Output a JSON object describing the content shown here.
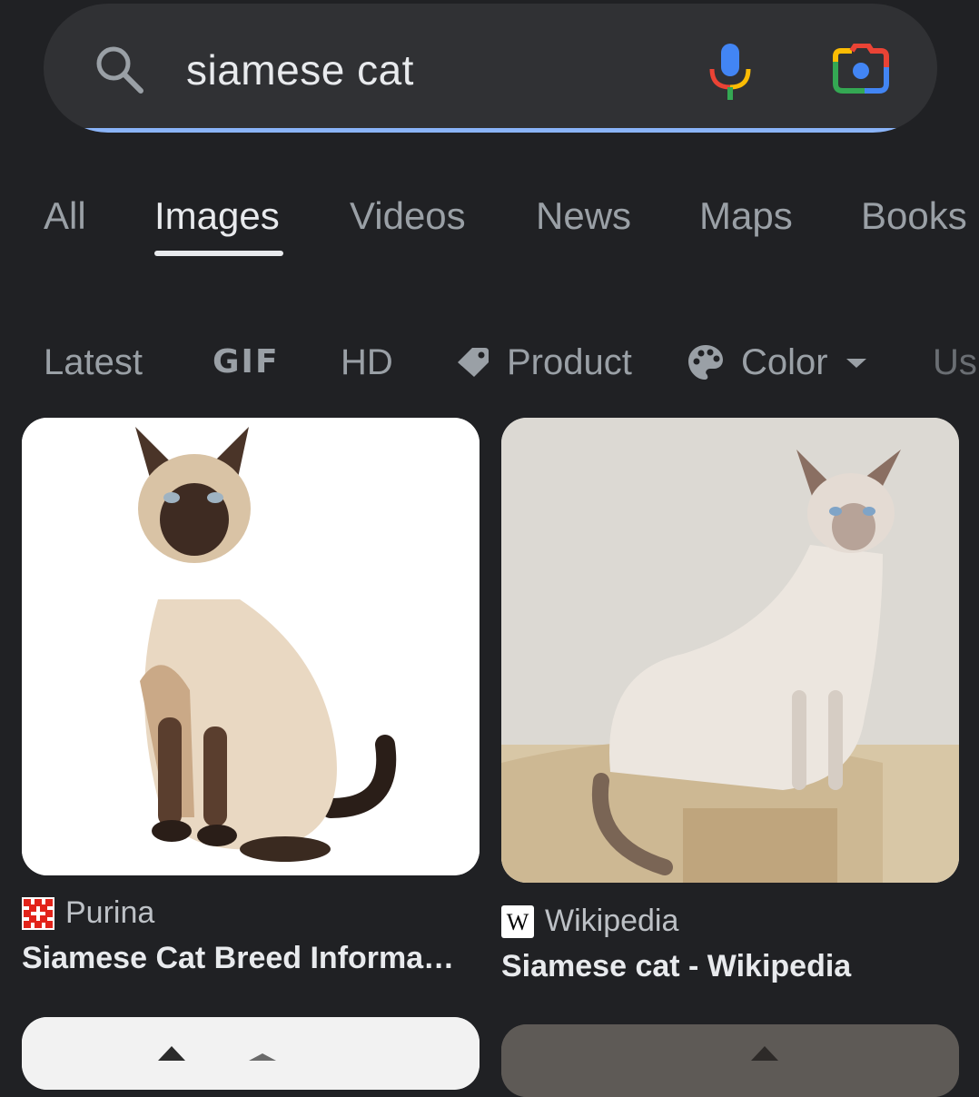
{
  "search": {
    "query": "siamese cat"
  },
  "tabs": [
    {
      "label": "All"
    },
    {
      "label": "Images"
    },
    {
      "label": "Videos"
    },
    {
      "label": "News"
    },
    {
      "label": "Maps"
    },
    {
      "label": "Books"
    }
  ],
  "active_tab": "Images",
  "chips": [
    {
      "label": "Latest"
    },
    {
      "label": "GIF"
    },
    {
      "label": "HD"
    },
    {
      "label": "Product",
      "icon": "tag-icon"
    },
    {
      "label": "Color",
      "icon": "palette-icon"
    },
    {
      "label": "Us"
    }
  ],
  "results": [
    {
      "source": "Purina",
      "title": "Siamese Cat Breed Informati…",
      "icon": "purina-logo-icon"
    },
    {
      "source": "Wikipedia",
      "title": "Siamese cat - Wikipedia",
      "icon": "wikipedia-logo-icon"
    }
  ],
  "colors": {
    "background": "#202124",
    "search_bar": "#303134",
    "accent_underline": "#8ab4f8"
  }
}
